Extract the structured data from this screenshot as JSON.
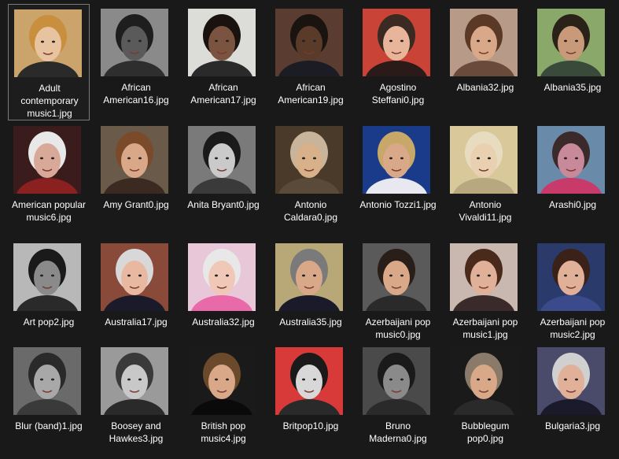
{
  "files": [
    {
      "name": "Adult contemporary music1.jpg",
      "bg": "#caa46b",
      "face": "#e8c3a0",
      "hair": "#c8903e",
      "cloth": "#2a2a2a",
      "selected": true
    },
    {
      "name": "African American16.jpg",
      "bg": "#8a8a8a",
      "face": "#5a5a5a",
      "hair": "#1e1e1e",
      "cloth": "#2e2e2e",
      "selected": false
    },
    {
      "name": "African American17.jpg",
      "bg": "#dcdcd8",
      "face": "#7a5440",
      "hair": "#1a120e",
      "cloth": "#2a2a2a",
      "selected": false
    },
    {
      "name": "African American19.jpg",
      "bg": "#5a3c30",
      "face": "#5a3a28",
      "hair": "#1a1410",
      "cloth": "#1c1c24",
      "selected": false
    },
    {
      "name": "Agostino Steffani0.jpg",
      "bg": "#c94436",
      "face": "#e8b49a",
      "hair": "#3a2a22",
      "cloth": "#2a1a18",
      "selected": false
    },
    {
      "name": "Albania32.jpg",
      "bg": "#b89a88",
      "face": "#d8a888",
      "hair": "#5a3a26",
      "cloth": "#6a4a3a",
      "selected": false
    },
    {
      "name": "Albania35.jpg",
      "bg": "#8aa86a",
      "face": "#c89a7a",
      "hair": "#2a2218",
      "cloth": "#3a4a3a",
      "selected": false
    },
    {
      "name": "American popular music6.jpg",
      "bg": "#3a1c1c",
      "face": "#d8a898",
      "hair": "#e8e8e8",
      "cloth": "#8a2020",
      "selected": false
    },
    {
      "name": "Amy Grant0.jpg",
      "bg": "#6a5a4a",
      "face": "#d8a888",
      "hair": "#7a4a2a",
      "cloth": "#3a2a22",
      "selected": false
    },
    {
      "name": "Anita Bryant0.jpg",
      "bg": "#7a7a7a",
      "face": "#cacaca",
      "hair": "#1a1a1a",
      "cloth": "#3a3a3a",
      "selected": false
    },
    {
      "name": "Antonio Caldara0.jpg",
      "bg": "#4a3a2a",
      "face": "#d8b08a",
      "hair": "#c8b49a",
      "cloth": "#5a4a3a",
      "selected": false
    },
    {
      "name": "Antonio Tozzi1.jpg",
      "bg": "#1a3a8a",
      "face": "#d8a888",
      "hair": "#c8a868",
      "cloth": "#e8e8f0",
      "selected": false
    },
    {
      "name": "Antonio Vivaldi11.jpg",
      "bg": "#d8c89a",
      "face": "#e8d0b0",
      "hair": "#e8dcc0",
      "cloth": "#b8a880",
      "selected": false
    },
    {
      "name": "Arashi0.jpg",
      "bg": "#6a8aaa",
      "face": "#c88a9a",
      "hair": "#3a2a2a",
      "cloth": "#c83a6a",
      "selected": false
    },
    {
      "name": "Art pop2.jpg",
      "bg": "#b8b8b8",
      "face": "#8a8a8a",
      "hair": "#1a1a1a",
      "cloth": "#2a2a2a",
      "selected": false
    },
    {
      "name": "Australia17.jpg",
      "bg": "#8a4a3a",
      "face": "#e8b8a0",
      "hair": "#d8d8d8",
      "cloth": "#1a1a2a",
      "selected": false
    },
    {
      "name": "Australia32.jpg",
      "bg": "#e8c8d8",
      "face": "#f0c8b8",
      "hair": "#e8e8e8",
      "cloth": "#e86aa8",
      "selected": false
    },
    {
      "name": "Australia35.jpg",
      "bg": "#b8a878",
      "face": "#d8a888",
      "hair": "#7a7a7a",
      "cloth": "#1a1a2a",
      "selected": false
    },
    {
      "name": "Azerbaijani pop music0.jpg",
      "bg": "#5a5a5a",
      "face": "#d8a888",
      "hair": "#2a1e18",
      "cloth": "#2a2a2a",
      "selected": false
    },
    {
      "name": "Azerbaijani pop music1.jpg",
      "bg": "#c8b8b0",
      "face": "#e0b098",
      "hair": "#4a2a1a",
      "cloth": "#3a2a2a",
      "selected": false
    },
    {
      "name": "Azerbaijani pop music2.jpg",
      "bg": "#2a3a6a",
      "face": "#e0b098",
      "hair": "#3a2218",
      "cloth": "#3a4a8a",
      "selected": false
    },
    {
      "name": "Blur (band)1.jpg",
      "bg": "#6a6a6a",
      "face": "#a8a8a8",
      "hair": "#2a2a2a",
      "cloth": "#3a3a3a",
      "selected": false
    },
    {
      "name": "Boosey and Hawkes3.jpg",
      "bg": "#9a9a9a",
      "face": "#c8c8c8",
      "hair": "#3a3a3a",
      "cloth": "#2a2a2a",
      "selected": false
    },
    {
      "name": "British pop music4.jpg",
      "bg": "#1a1a1a",
      "face": "#d8a888",
      "hair": "#6a4a2a",
      "cloth": "#0a0a0a",
      "selected": false
    },
    {
      "name": "Britpop10.jpg",
      "bg": "#d83a3a",
      "face": "#d8d8d8",
      "hair": "#1a1a1a",
      "cloth": "#2a2a2a",
      "selected": false
    },
    {
      "name": "Bruno Maderna0.jpg",
      "bg": "#4a4a4a",
      "face": "#8a8a8a",
      "hair": "#1a1a1a",
      "cloth": "#2a2a2a",
      "selected": false
    },
    {
      "name": "Bubblegum pop0.jpg",
      "bg": "#1a1a1a",
      "face": "#d8a888",
      "hair": "#8a7a6a",
      "cloth": "#2a2a2a",
      "selected": false
    },
    {
      "name": "Bulgaria3.jpg",
      "bg": "#4a4a6a",
      "face": "#e0b098",
      "hair": "#d0d0d0",
      "cloth": "#1a1a2a",
      "selected": false
    }
  ]
}
